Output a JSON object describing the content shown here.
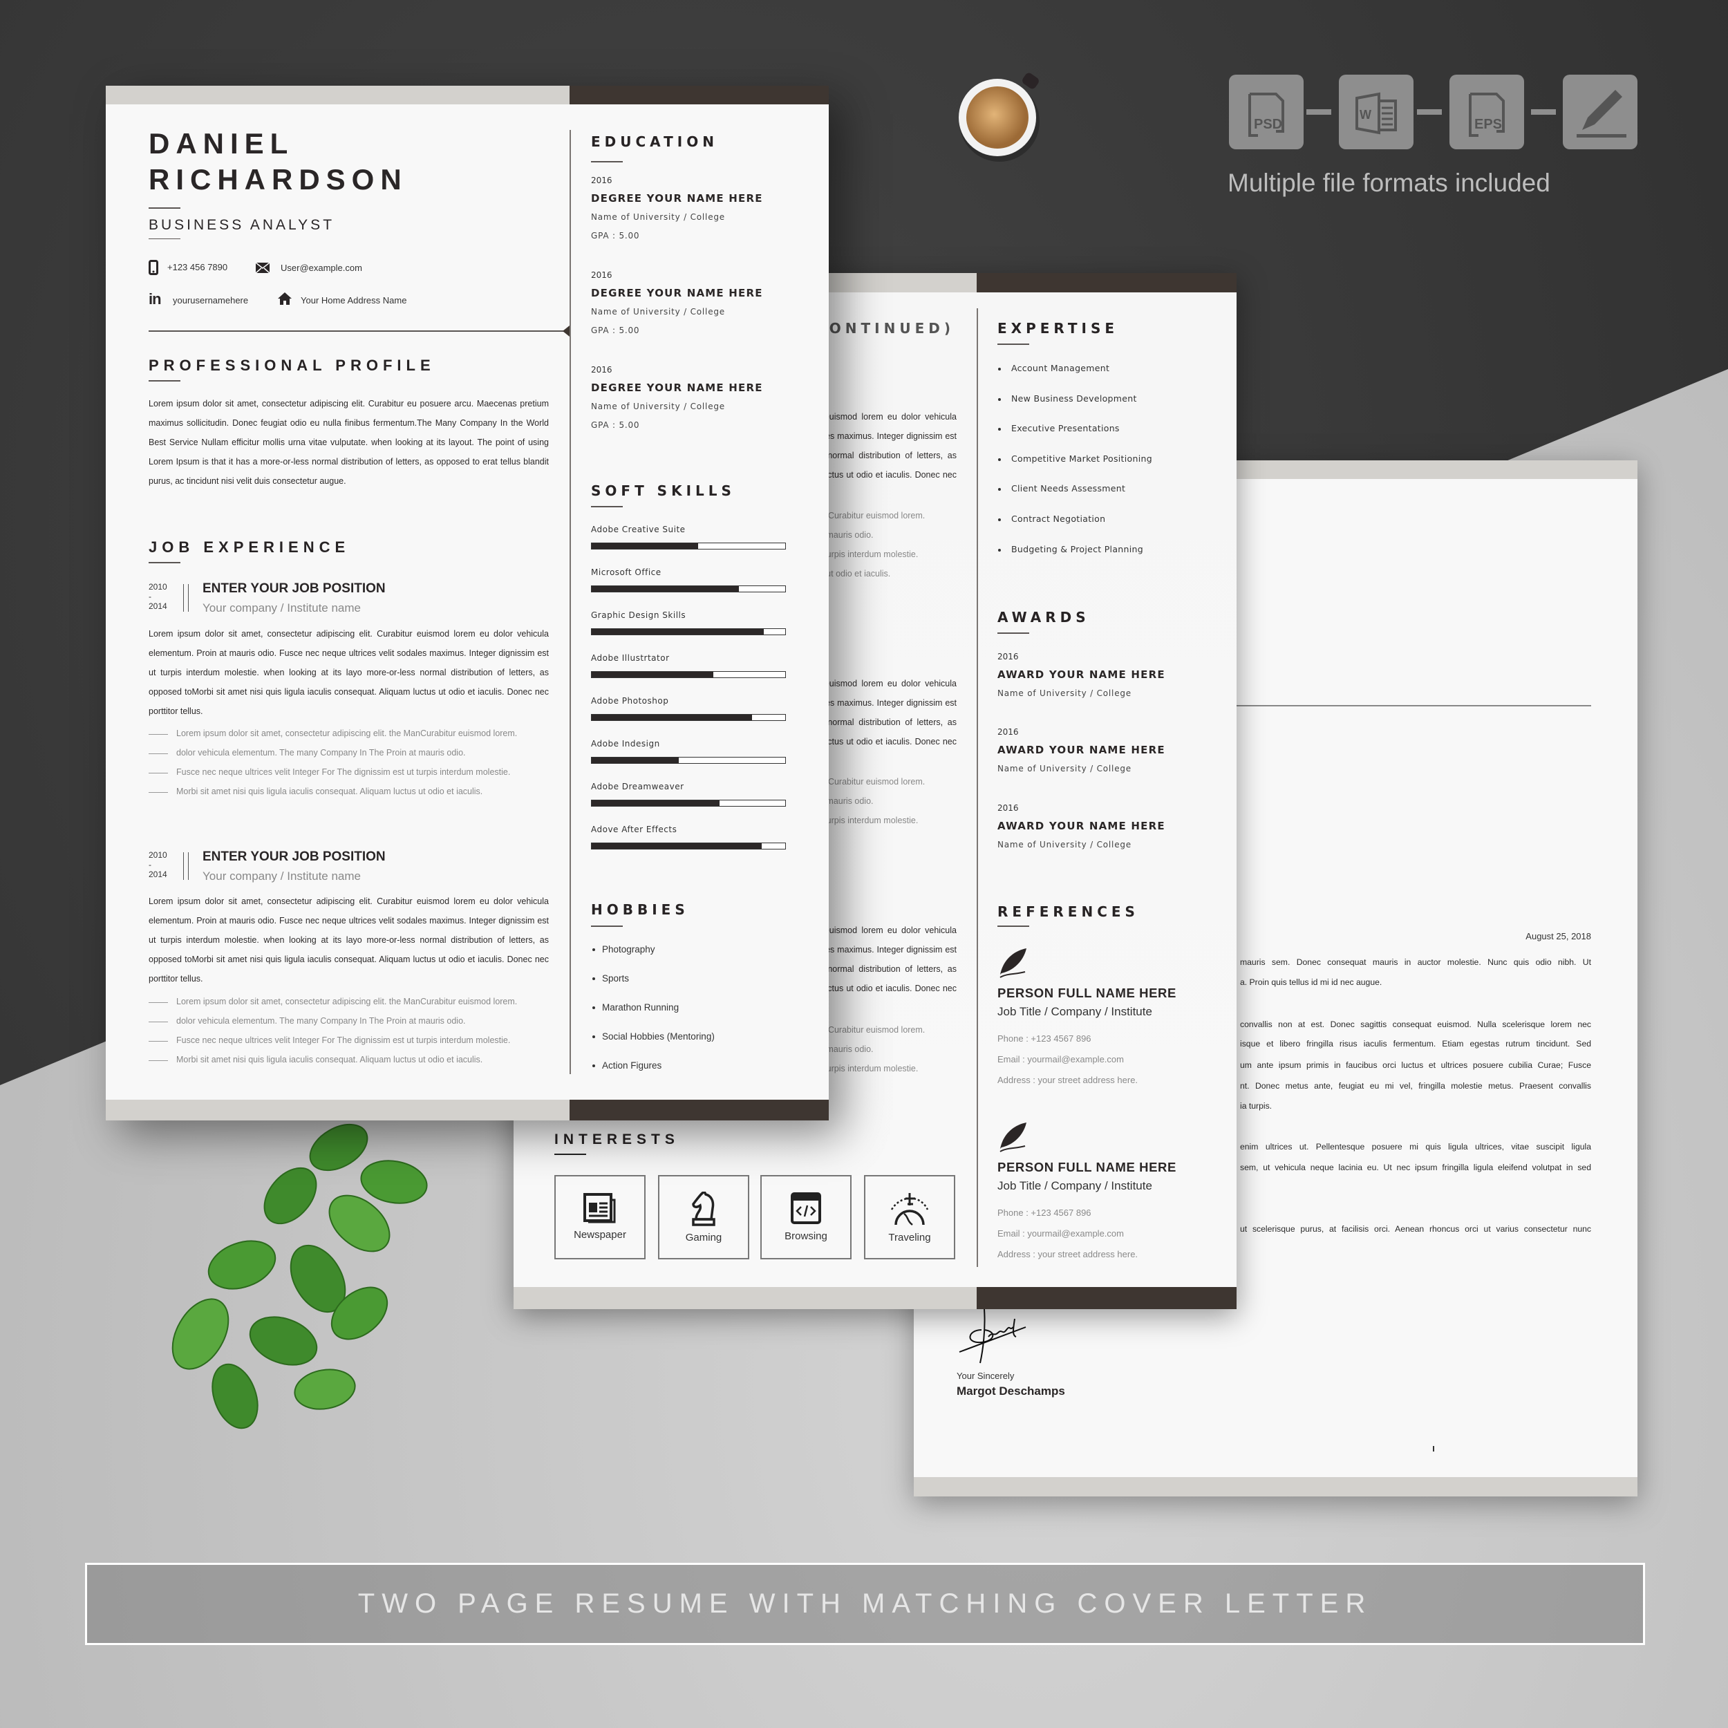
{
  "promo": {
    "formats_caption": "Multiple file formats included",
    "formats": [
      {
        "icon": "psd-file-icon",
        "label": "PSD"
      },
      {
        "icon": "word-file-icon",
        "label": "W"
      },
      {
        "icon": "eps-file-icon",
        "label": "EPS"
      },
      {
        "icon": "pen-edit-icon",
        "label": ""
      }
    ],
    "banner": "TWO PAGE RESUME WITH MATCHING COVER LETTER"
  },
  "colors": {
    "dark_band": "#3e3631",
    "light_band": "#d3d1cd",
    "background_dark": "#3a3a3a",
    "background_light": "#c6c6c6"
  },
  "resume": {
    "first_name": "DANIEL",
    "last_name": "RICHARDSON",
    "title": "BUSINESS ANALYST",
    "contact": {
      "phone": "+123 456 7890",
      "email": "User@example.com",
      "linkedin": "yourusernamehere",
      "address": "Your Home Address Name"
    },
    "profile_heading": "PROFESSIONAL PROFILE",
    "profile_text": "Lorem ipsum dolor sit amet, consectetur adipiscing elit. Curabitur eu posuere arcu. Maecenas pretium maximus sollicitudin. Donec feugiat odio eu nulla finibus fermentum.The Many Company In the World Best Service Nullam efficitur mollis urna vitae vulputate.  when looking at its layout. The point of using Lorem Ipsum is that it has a more-or-less normal distribution of letters, as opposed to erat tellus blandit purus, ac tincidunt nisi velit duis consectetur augue.",
    "experience_heading": "JOB EXPERIENCE",
    "jobs": [
      {
        "start": "2010",
        "sep": "-",
        "end": "2014",
        "position": "ENTER YOUR JOB POSITION",
        "company": "Your company / Institute name",
        "description": "Lorem ipsum dolor sit amet, consectetur adipiscing elit. Curabitur euismod lorem eu dolor vehicula elementum. Proin at mauris odio. Fusce nec neque ultrices velit sodales maximus. Integer dignissim est ut turpis interdum molestie.  when looking at its layo more-or-less normal distribution of letters, as opposed toMorbi sit amet nisi quis ligula iaculis consequat. Aliquam luctus ut odio et iaculis. Donec nec porttitor tellus.",
        "bullets": [
          "Lorem ipsum dolor sit amet, consectetur adipiscing elit. the ManCurabitur euismod lorem.",
          "dolor vehicula elementum. The many Company In The Proin at mauris odio.",
          "Fusce nec neque ultrices velit Integer For The dignissim est ut turpis interdum molestie.",
          "Morbi sit amet nisi quis ligula iaculis consequat. Aliquam luctus ut odio et iaculis."
        ]
      },
      {
        "start": "2010",
        "sep": "-",
        "end": "2014",
        "position": "ENTER YOUR JOB POSITION",
        "company": "Your company / Institute name",
        "description": "Lorem ipsum dolor sit amet, consectetur adipiscing elit. Curabitur euismod lorem eu dolor vehicula elementum. Proin at mauris odio. Fusce nec neque ultrices velit sodales maximus. Integer dignissim est ut turpis interdum molestie.  when looking at its layo more-or-less normal distribution of letters, as opposed toMorbi sit amet nisi quis ligula iaculis consequat. Aliquam luctus ut odio et iaculis. Donec nec porttitor tellus.",
        "bullets": [
          "Lorem ipsum dolor sit amet, consectetur adipiscing elit. the ManCurabitur euismod lorem.",
          "dolor vehicula elementum. The many Company In The Proin at mauris odio.",
          "Fusce nec neque ultrices velit Integer For The dignissim est ut turpis interdum molestie.",
          "Morbi sit amet nisi quis ligula iaculis consequat. Aliquam luctus ut odio et iaculis."
        ]
      }
    ],
    "education_heading": "EDUCATION",
    "education": [
      {
        "year": "2016",
        "degree": "DEGREE YOUR NAME HERE",
        "school": "Name of University / College",
        "gpa": "GPA : 5.00"
      },
      {
        "year": "2016",
        "degree": "DEGREE YOUR NAME HERE",
        "school": "Name of University / College",
        "gpa": "GPA : 5.00"
      },
      {
        "year": "2016",
        "degree": "DEGREE YOUR NAME HERE",
        "school": "Name of University / College",
        "gpa": "GPA : 5.00"
      }
    ],
    "skills_heading": "SOFT SKILLS",
    "skills": [
      {
        "name": "Adobe Creative Suite",
        "level": 0.55
      },
      {
        "name": "Microsoft Office",
        "level": 0.76
      },
      {
        "name": "Graphic Design Skills",
        "level": 0.89
      },
      {
        "name": "Adobe Illustrtator",
        "level": 0.63
      },
      {
        "name": "Adobe Photoshop",
        "level": 0.83
      },
      {
        "name": "Adobe Indesign",
        "level": 0.45
      },
      {
        "name": "Adobe Dreamweaver",
        "level": 0.66
      },
      {
        "name": "Adove After Effects",
        "level": 0.88
      }
    ],
    "hobbies_heading": "HOBBIES",
    "hobbies": [
      "Photography",
      "Sports",
      "Marathon Running",
      "Social Hobbies (Mentoring)",
      "Action Figures"
    ],
    "page2": {
      "continued": "(CONTINUED)",
      "expertise_heading": "EXPERTISE",
      "expertise": [
        "Account Management",
        "New Business Development",
        "Executive Presentations",
        "Competitive Market Positioning",
        "Client Needs Assessment",
        "Contract Negotiation",
        "Budgeting & Project Planning"
      ],
      "awards_heading": "AWARDS",
      "awards": [
        {
          "year": "2016",
          "name": "AWARD YOUR NAME HERE",
          "school": "Name of University / College"
        },
        {
          "year": "2016",
          "name": "AWARD YOUR NAME HERE",
          "school": "Name of University / College"
        },
        {
          "year": "2016",
          "name": "AWARD YOUR NAME HERE",
          "school": "Name of University / College"
        }
      ],
      "references_heading": "REFERENCES",
      "references": [
        {
          "name": "PERSON FULL NAME HERE",
          "title": "Job Title / Company / Institute",
          "phone": "Phone  :  +123 4567 896",
          "email": "Email  :  yourmail@example.com",
          "address": "Address : your street address here."
        },
        {
          "name": "PERSON FULL NAME HERE",
          "title": "Job Title / Company / Institute",
          "phone": "Phone  :  +123 4567 896",
          "email": "Email  :  yourmail@example.com",
          "address": "Address : your street address here."
        }
      ],
      "interests_heading": "INTERESTS",
      "interests": [
        {
          "icon": "newspaper-icon",
          "label": "Newspaper"
        },
        {
          "icon": "chess-knight-icon",
          "label": "Gaming"
        },
        {
          "icon": "browser-code-icon",
          "label": "Browsing"
        },
        {
          "icon": "globe-plane-icon",
          "label": "Traveling"
        }
      ]
    }
  },
  "cover_letter": {
    "date": "August 25, 2018",
    "lines": [
      "mauris sem. Donec consequat mauris in auctor molestie. Nunc quis odio nibh. Ut",
      "a. Proin quis tellus id mi  id nec augue.",
      "convallis non at est. Donec sagittis consequat euismod. Nulla scelerisque lorem nec",
      "isque et libero fringilla risus iaculis fermentum. Etiam egestas rutrum tincidunt. Sed",
      "um ante ipsum primis in faucibus orci luctus et ultrices posuere cubilia Curae; Fusce",
      "nt. Donec metus ante, feugiat eu mi vel, fringilla molestie metus. Praesent convallis",
      "ia turpis.",
      "enim ultrices ut. Pellentesque posuere mi quis ligula ultrices, vitae suscipit ligula",
      "sem, ut vehicula neque lacinia eu. Ut nec ipsum fringilla ligula eleifend volutpat in sed",
      "ut scelerisque purus, at facilisis orci. Aenean rhoncus orci ut varius consectetur nunc"
    ],
    "closing": "Your Sincerely",
    "signer": "Margot Deschamps"
  }
}
